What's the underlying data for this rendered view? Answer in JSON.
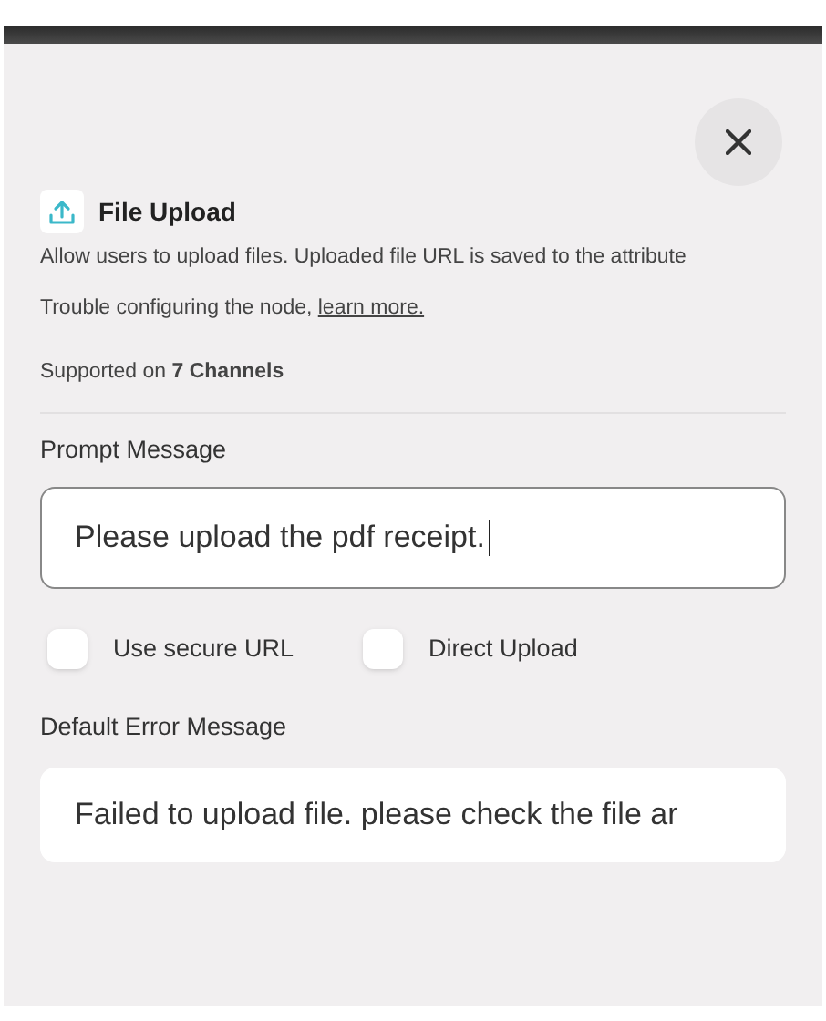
{
  "panel": {
    "title": "File Upload",
    "description": "Allow users to upload files. Uploaded file URL is saved to the attribute",
    "help_text": "Trouble configuring the node, ",
    "help_link": "learn more.",
    "support": "Supported on **7 Channels**"
  },
  "prompt": {
    "label": "Prompt Message",
    "value": "Please upload the pdf receipt.",
    "focused": true
  },
  "options": [
    {
      "label": "Use secure URL",
      "checked": false
    },
    {
      "label": "Direct Upload",
      "checked": false
    }
  ],
  "error": {
    "label": "Default Error Message",
    "value": "Failed to upload file. please check the file ar",
    "focused": false
  }
}
